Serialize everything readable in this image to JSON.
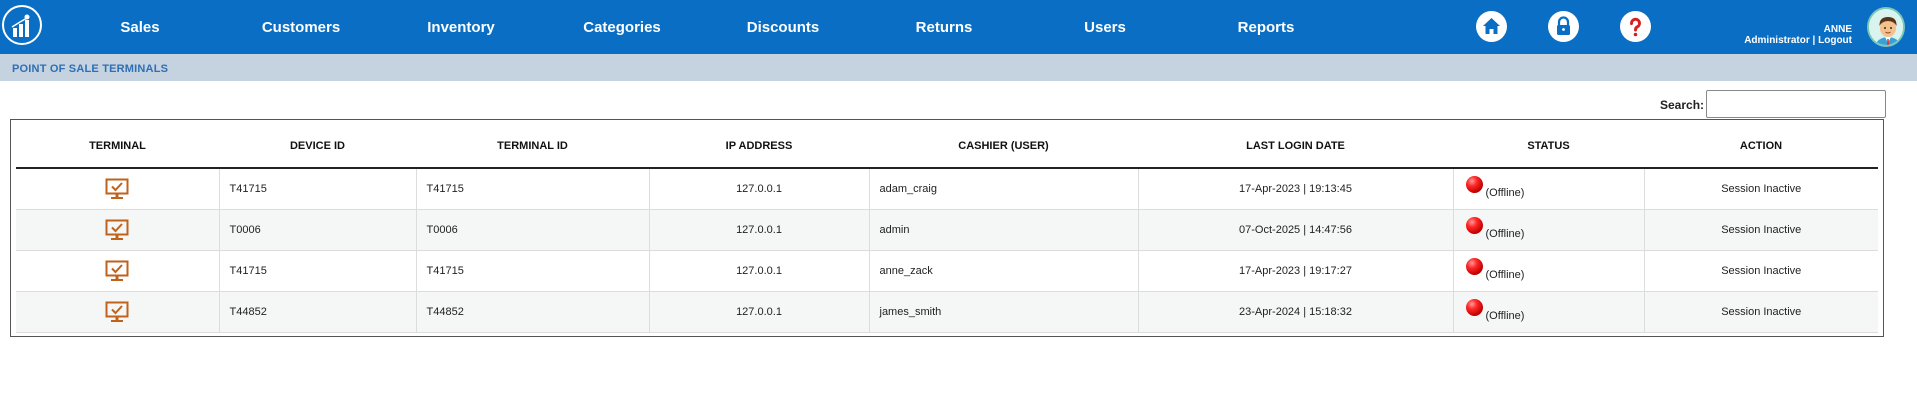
{
  "nav": {
    "items": [
      {
        "label": "Sales"
      },
      {
        "label": "Customers"
      },
      {
        "label": "Inventory"
      },
      {
        "label": "Categories"
      },
      {
        "label": "Discounts"
      },
      {
        "label": "Returns"
      },
      {
        "label": "Users"
      },
      {
        "label": "Reports"
      }
    ],
    "icons": [
      "home-icon",
      "lock-icon",
      "help-icon"
    ]
  },
  "user": {
    "name": "ANNE",
    "role": "Administrator",
    "separator": "|",
    "logout": "Logout"
  },
  "page": {
    "title": "POINT OF SALE TERMINALS"
  },
  "search": {
    "label": "Search:",
    "value": ""
  },
  "table": {
    "columns": [
      "TERMINAL",
      "DEVICE ID",
      "TERMINAL ID",
      "IP ADDRESS",
      "CASHIER (USER)",
      "LAST LOGIN DATE",
      "STATUS",
      "ACTION"
    ],
    "rows": [
      {
        "device_id": "T41715",
        "terminal_id": "T41715",
        "ip": "127.0.0.1",
        "cashier": "adam_craig",
        "last_login": "17-Apr-2023 | 19:13:45",
        "status": "(Offline)",
        "action": "Session Inactive"
      },
      {
        "device_id": "T0006",
        "terminal_id": "T0006",
        "ip": "127.0.0.1",
        "cashier": "admin",
        "last_login": "07-Oct-2025 | 14:47:56",
        "status": "(Offline)",
        "action": "Session Inactive"
      },
      {
        "device_id": "T41715",
        "terminal_id": "T41715",
        "ip": "127.0.0.1",
        "cashier": "anne_zack",
        "last_login": "17-Apr-2023 | 19:17:27",
        "status": "(Offline)",
        "action": "Session Inactive"
      },
      {
        "device_id": "T44852",
        "terminal_id": "T44852",
        "ip": "127.0.0.1",
        "cashier": "james_smith",
        "last_login": "23-Apr-2024 | 15:18:32",
        "status": "(Offline)",
        "action": "Session Inactive"
      }
    ]
  },
  "colors": {
    "topbar": "#0a6fc4",
    "titlebar": "#c5d2e0",
    "status_offline": "#e00000",
    "terminal_icon": "#c0621b"
  }
}
